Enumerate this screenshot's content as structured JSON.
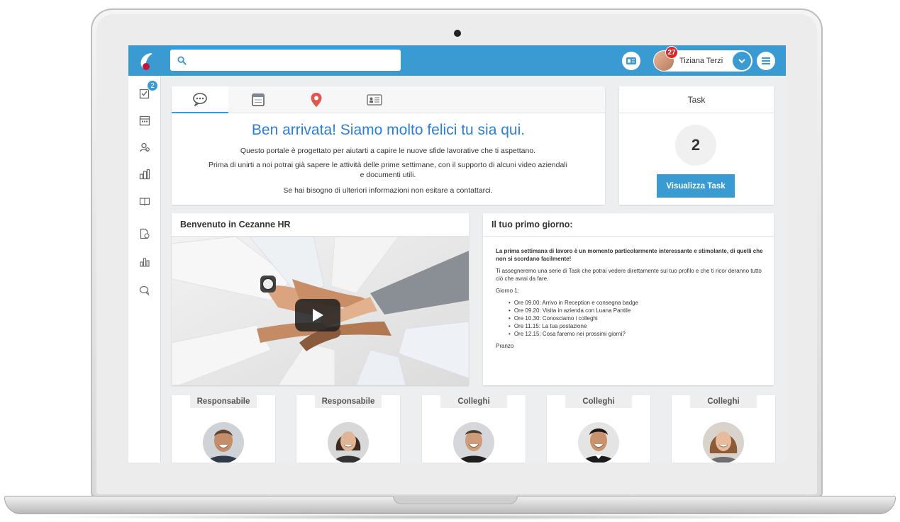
{
  "search": {
    "placeholder": ""
  },
  "header": {
    "notification_count": "27",
    "user_name": "Tiziana Terzi"
  },
  "sidebar": {
    "items": [
      {
        "name": "tasks-icon",
        "badge": "2"
      },
      {
        "name": "calendar-icon"
      },
      {
        "name": "people-icon"
      },
      {
        "name": "organization-icon"
      },
      {
        "name": "book-icon"
      },
      {
        "name": "documents-icon"
      },
      {
        "name": "chart-icon"
      },
      {
        "name": "chat-icon"
      }
    ]
  },
  "welcome": {
    "tabs": [
      "chat-bubble-icon",
      "calendar-icon",
      "map-pin-icon",
      "id-card-icon"
    ],
    "title": "Ben arrivata! Siamo molto felici tu sia qui.",
    "line1": "Questo portale è progettato per aiutarti a capire le nuove sfide lavorative che ti aspettano.",
    "line2": "Prima di unirti a noi potrai già sapere le attività delle prime settimane, con il supporto di alcuni video aziendali e documenti utili.",
    "line3": "Se hai bisogno di ulteriori informazioni non esitare a contattarci."
  },
  "task": {
    "title": "Task",
    "count": "2",
    "button_label": "Visualizza Task"
  },
  "video_card": {
    "title": "Benvenuto in Cezanne HR"
  },
  "first_day": {
    "title": "Il tuo primo giorno:",
    "intro": "La prima settimana di lavoro è un momento particolarmente interessante e stimolante, di quelli che non si scordano facilmente!",
    "text": "Ti assegneremo una serie di Task che potrai vedere direttamente sul tuo profilo e che ti ricor deranno tutto ciò che avrai da fare.",
    "day_label": "Giorno 1:",
    "items": [
      "Ore 09.00: Arrivo in Reception e consegna badge",
      "Ore 09.20: Visita in azienda con Luana Pantile",
      "Ore 10.30: Conosciamo i colleghi",
      "Ore 11.15: La tua postazione",
      "Ore 12.15: Cosa faremo nei prossimi giorni?"
    ],
    "closing": "Pranzo"
  },
  "people": [
    {
      "role": "Responsabile"
    },
    {
      "role": "Responsabile"
    },
    {
      "role": "Colleghi"
    },
    {
      "role": "Colleghi"
    },
    {
      "role": "Colleghi"
    }
  ],
  "colors": {
    "primary": "#3a9bd3",
    "title_blue": "#2a7fd4",
    "badge_red": "#e02424"
  }
}
